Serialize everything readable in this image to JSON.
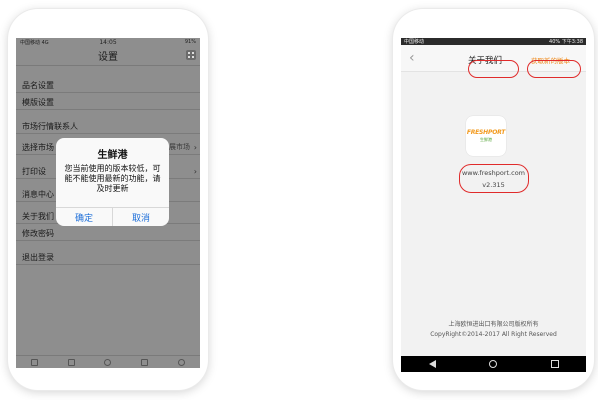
{
  "left_phone": {
    "status": {
      "carrier": "中国移动 4G",
      "time": "14:05",
      "battery": "91%"
    },
    "nav_title": "设置",
    "rows": [
      {
        "label": "品名设置",
        "value": "",
        "chevron": false
      },
      {
        "label": "模版设置",
        "value": "",
        "chevron": false
      },
      {
        "label": "市场行情联系人",
        "value": "",
        "chevron": false
      },
      {
        "label": "选择市场",
        "value": "辉展市场",
        "chevron": true
      },
      {
        "label": "打印设",
        "value": "",
        "chevron": true
      },
      {
        "label": "消息中心",
        "value": "",
        "chevron": false
      },
      {
        "label": "关于我们",
        "value": "",
        "chevron": false
      },
      {
        "label": "修改密码",
        "value": "",
        "chevron": false
      },
      {
        "label": "退出登录",
        "value": "",
        "chevron": false
      }
    ],
    "dialog": {
      "title": "生鲜港",
      "message": "您当前使用的版本较低，可能不能使用最新的功能，请及时更新",
      "confirm": "确定",
      "cancel": "取消"
    }
  },
  "right_phone": {
    "status": {
      "carrier": "中国移动",
      "battery": "40%",
      "time": "下午3:38"
    },
    "nav_title": "关于我们",
    "get_version": "获取新的版本",
    "logo": {
      "brand": "FRESHPORT",
      "sub": "生鲜港"
    },
    "website": "www.freshport.com",
    "version": "v2.315",
    "copyright_cn": "上海欧恒进出口有限公司版权所有",
    "copyright_en": "CopyRight©2014-2017 All Right Reserved"
  },
  "colors": {
    "highlight_ring": "#e02b2b",
    "accent_orange": "#f08a1c",
    "ios_blue": "#1e6fd9"
  }
}
